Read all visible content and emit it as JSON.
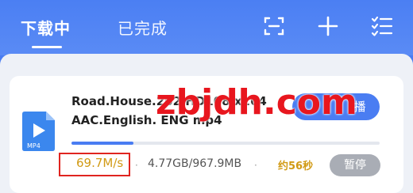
{
  "tabs": {
    "downloading": "下载中",
    "completed": "已完成"
  },
  "header_icons": [
    "scan-icon",
    "plus-icon",
    "list-check-icon"
  ],
  "download": {
    "filename_line1": "Road.House.202",
    "filename_line1_b": "HD108",
    "filename_line1_c": "x264",
    "filename_line2": "AAC.English.",
    "filename_line2_b": "ENG",
    "filename_line2_c": "mp4",
    "file_type": "MP4",
    "action_label": "播",
    "speed": "69.7M/s",
    "separator": "·",
    "size": "4.77GB/967.9MB",
    "remaining": "约56秒",
    "pause_label": "暂停",
    "progress_fraction": 0.2
  },
  "watermark": "zbjdh.com",
  "colors": {
    "accent": "#4a7df2",
    "speed": "#d19a14",
    "highlight_border": "#e0241f",
    "watermark": "#e8161e"
  }
}
